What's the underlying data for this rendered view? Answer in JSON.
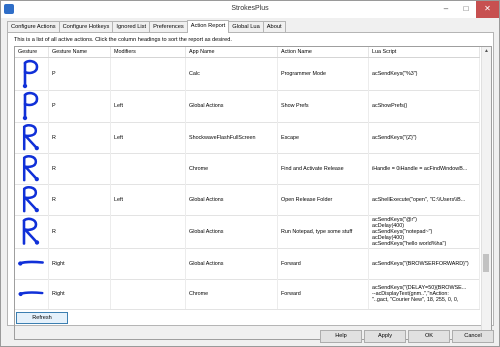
{
  "window": {
    "title": "StrokesPlus",
    "minimize": "–",
    "maximize": "□",
    "close": "✕"
  },
  "tabs": [
    "Configure Actions",
    "Configure Hotkeys",
    "Ignored List",
    "Preferences",
    "Action Report",
    "Global Lua",
    "About"
  ],
  "active_tab": "Action Report",
  "description": "This is a list of all active actions.  Click the column headings to sort the report as desired.",
  "columns": [
    "Gesture",
    "Gesture Name",
    "Modifiers",
    "App Name",
    "Action Name",
    "Lua Script"
  ],
  "gesture_color": "#1030d8",
  "rows": [
    {
      "gesture": "P",
      "gesture_name": "P",
      "modifiers": "",
      "app": "Calc",
      "action": "Programmer Mode",
      "script": "acSendKeys(\"%3\")"
    },
    {
      "gesture": "P",
      "gesture_name": "P",
      "modifiers": "Left",
      "app": "Global Actions",
      "action": "Show Prefs",
      "script": "acShowPrefs()"
    },
    {
      "gesture": "R",
      "gesture_name": "R",
      "modifiers": "Left",
      "app": "ShockwaveFlashFullScreen",
      "action": "Escape",
      "script": "acSendKeys(\"{Z}\")"
    },
    {
      "gesture": "R",
      "gesture_name": "R",
      "modifiers": "",
      "app": "Chrome",
      "action": "Find and Activate Release",
      "script": "iHandle = 0iHandle = acFindWindowB..."
    },
    {
      "gesture": "R",
      "gesture_name": "R",
      "modifiers": "Left",
      "app": "Global Actions",
      "action": "Open Release Folder",
      "script": "acShellExecute(\"open\", \"C:\\\\Users\\\\B..."
    },
    {
      "gesture": "R",
      "gesture_name": "R",
      "modifiers": "",
      "app": "Global Actions",
      "action": "Run Notepad, type some stuff",
      "script": "acSendKeys(\"@r\")\nacDelay(400)\nacSendKeys(\"notepad~\")\nacDelay(400)\nacSendKeys(\"hello world%ha\")"
    },
    {
      "gesture": "line",
      "gesture_name": "Right",
      "modifiers": "",
      "app": "Global Actions",
      "action": "Forward",
      "script": "acSendKeys(\"{BROWSERFORWARD}\")"
    },
    {
      "gesture": "line",
      "gesture_name": "Right",
      "modifiers": "",
      "app": "Chrome",
      "action": "Forward",
      "script": "acSendKeys(\"{DELAY=50}{BROWSE...\n--acDisplayText(gnm..\",\"nAction:\n\"..gact, \"Courier New\", 18, 255, 0, 0,"
    }
  ],
  "scroll_up": "▲",
  "scroll_down": "▼",
  "buttons": {
    "refresh": "Refresh",
    "help": "Help",
    "apply": "Apply",
    "ok": "OK",
    "cancel": "Cancel"
  }
}
